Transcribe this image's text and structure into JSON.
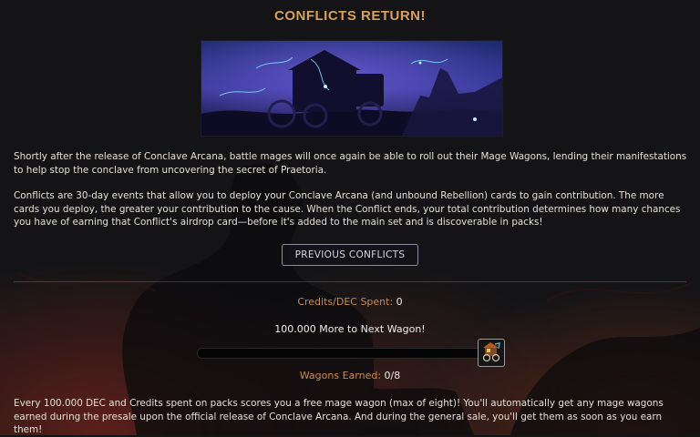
{
  "title": "CONFLICTS RETURN!",
  "banner": {
    "icon": "mage-wagon-banner-art"
  },
  "paragraph1": "Shortly after the release of Conclave Arcana, battle mages will once again be able to roll out their Mage Wagons, lending their manifestations to help stop the conclave from uncovering the secret of Praetoria.",
  "paragraph2": "Conflicts are 30-day events that allow you to deploy your Conclave Arcana (and unbound Rebellion) cards to gain contribution. The more cards you deploy, the greater your contribution to the cause. When the Conflict ends, your total contribution determines how many chances you have of earning that Conflict's airdrop card—before it's added to the main set and is discoverable in packs!",
  "previous_button": "PREVIOUS CONFLICTS",
  "credits": {
    "label": "Credits/DEC Spent:",
    "value": "0"
  },
  "next_wagon": "100.000 More to Next Wagon!",
  "progress": {
    "fraction": 0
  },
  "wagon_icon": "mage-wagon-icon",
  "wagons": {
    "label": "Wagons Earned:",
    "value": "0/8"
  },
  "footer": "Every 100.000 DEC and Credits spent on packs scores you a free mage wagon (max of eight)! You'll automatically get any mage wagons earned during the presale upon the official release of Conclave Arcana. And during the general sale, you'll get them as soon as you earn them!",
  "colors": {
    "accent": "#d8a05a",
    "label": "#c98b4c",
    "background": "#141416"
  }
}
